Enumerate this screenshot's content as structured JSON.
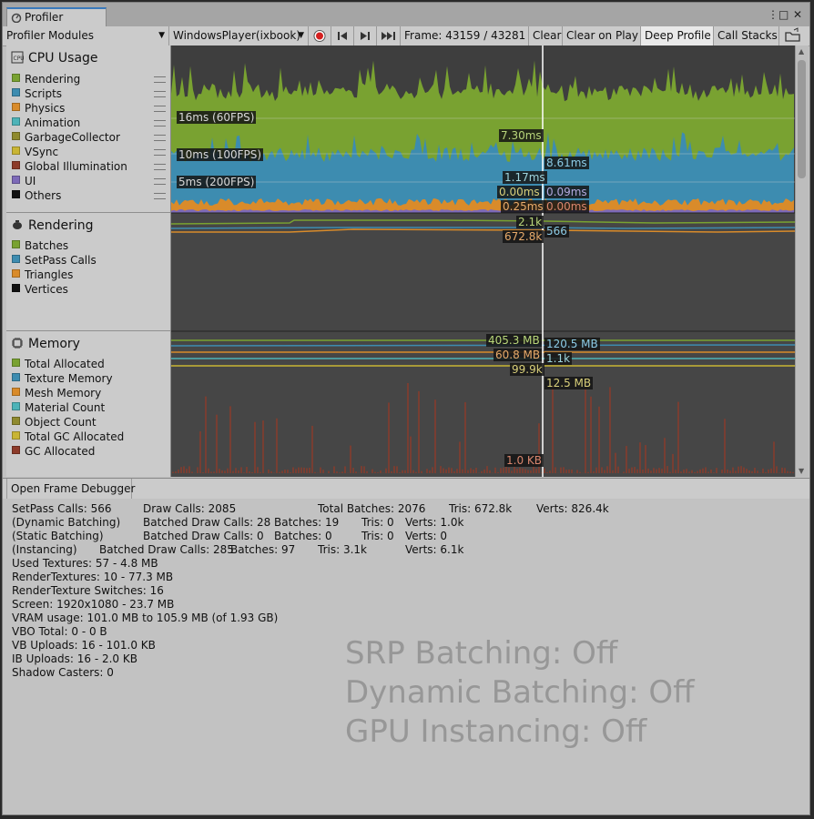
{
  "window": {
    "tab_title": "Profiler",
    "menu_dots": "⋮",
    "maximize": "□",
    "close": "✕"
  },
  "toolbar": {
    "modules_label": "Profiler Modules",
    "target_label": "WindowsPlayer(ixbook)",
    "frame_label": "Frame: 43159 / 43281",
    "clear": "Clear",
    "clear_on_play": "Clear on Play",
    "deep_profile": "Deep Profile",
    "call_stacks": "Call Stacks"
  },
  "modules": {
    "cpu": {
      "title": "CPU Usage",
      "items": [
        {
          "label": "Rendering",
          "color": "#79a231"
        },
        {
          "label": "Scripts",
          "color": "#3d8cb0"
        },
        {
          "label": "Physics",
          "color": "#d98b2a"
        },
        {
          "label": "Animation",
          "color": "#4db3b8"
        },
        {
          "label": "GarbageCollector",
          "color": "#8f8a2e"
        },
        {
          "label": "VSync",
          "color": "#c9b534"
        },
        {
          "label": "Global Illumination",
          "color": "#8d3b2a"
        },
        {
          "label": "UI",
          "color": "#7d6ab8"
        },
        {
          "label": "Others",
          "color": "#101010"
        }
      ]
    },
    "rendering": {
      "title": "Rendering",
      "items": [
        {
          "label": "Batches",
          "color": "#79a231"
        },
        {
          "label": "SetPass Calls",
          "color": "#3d8cb0"
        },
        {
          "label": "Triangles",
          "color": "#d98b2a"
        },
        {
          "label": "Vertices",
          "color": "#101010"
        }
      ]
    },
    "memory": {
      "title": "Memory",
      "items": [
        {
          "label": "Total Allocated",
          "color": "#79a231"
        },
        {
          "label": "Texture Memory",
          "color": "#3d8cb0"
        },
        {
          "label": "Mesh Memory",
          "color": "#d98b2a"
        },
        {
          "label": "Material Count",
          "color": "#4db3b8"
        },
        {
          "label": "Object Count",
          "color": "#8f8a2e"
        },
        {
          "label": "Total GC Allocated",
          "color": "#c9b534"
        },
        {
          "label": "GC Allocated",
          "color": "#8d3b2a"
        }
      ]
    }
  },
  "graph_labels": {
    "cpu_16ms": "16ms (60FPS)",
    "cpu_10ms": "10ms (100FPS)",
    "cpu_5ms": "5ms (200FPS)",
    "cpu_a": "7.30ms",
    "cpu_b": "8.61ms",
    "cpu_c": "1.17ms",
    "cpu_d": "0.00ms",
    "cpu_e": "0.09ms",
    "cpu_f": "0.25ms",
    "cpu_g": "0.00ms",
    "rend_a": "2.1k",
    "rend_b": "672.8k",
    "rend_c": "566",
    "mem_a": "405.3 MB",
    "mem_b": "120.5 MB",
    "mem_c": "60.8 MB",
    "mem_d": "1.1k",
    "mem_e": "99.9k",
    "mem_f": "12.5 MB",
    "mem_g": "1.0 KB"
  },
  "bottom": {
    "frame_debugger": "Open Frame Debugger"
  },
  "details": {
    "r1": {
      "setpass": "SetPass Calls: 566",
      "draw": "Draw Calls: 2085",
      "batches": "Total Batches: 2076",
      "tris": "Tris: 672.8k",
      "verts": "Verts: 826.4k"
    },
    "r2": {
      "a": "(Dynamic Batching)",
      "b": "Batched Draw Calls: 28",
      "c": "Batches: 19",
      "d": "Tris: 0",
      "e": "Verts: 1.0k"
    },
    "r3": {
      "a": "(Static Batching)",
      "b": "Batched Draw Calls: 0",
      "c": "Batches: 0",
      "d": "Tris: 0",
      "e": "Verts: 0"
    },
    "r4": {
      "a": "(Instancing)",
      "b": "Batched Draw Calls: 285",
      "c": "Batches: 97",
      "d": "Tris: 3.1k",
      "e": "Verts: 6.1k"
    },
    "lines": [
      "Used Textures: 57 - 4.8 MB",
      "RenderTextures: 10 - 77.3 MB",
      "RenderTexture Switches: 16",
      "Screen: 1920x1080 - 23.7 MB",
      "VRAM usage: 101.0 MB to 105.9 MB (of 1.93 GB)",
      "VBO Total: 0 - 0 B",
      "VB Uploads: 16 - 101.0 KB",
      "IB Uploads: 16 - 2.0 KB",
      "Shadow Casters: 0"
    ],
    "srp": "SRP Batching: Off",
    "dyn": "Dynamic Batching: Off",
    "gpu": "GPU Instancing: Off"
  },
  "colors": {
    "graph_bg": "#464646",
    "cursor": "#ffffff",
    "accent": "#3a79bb"
  }
}
